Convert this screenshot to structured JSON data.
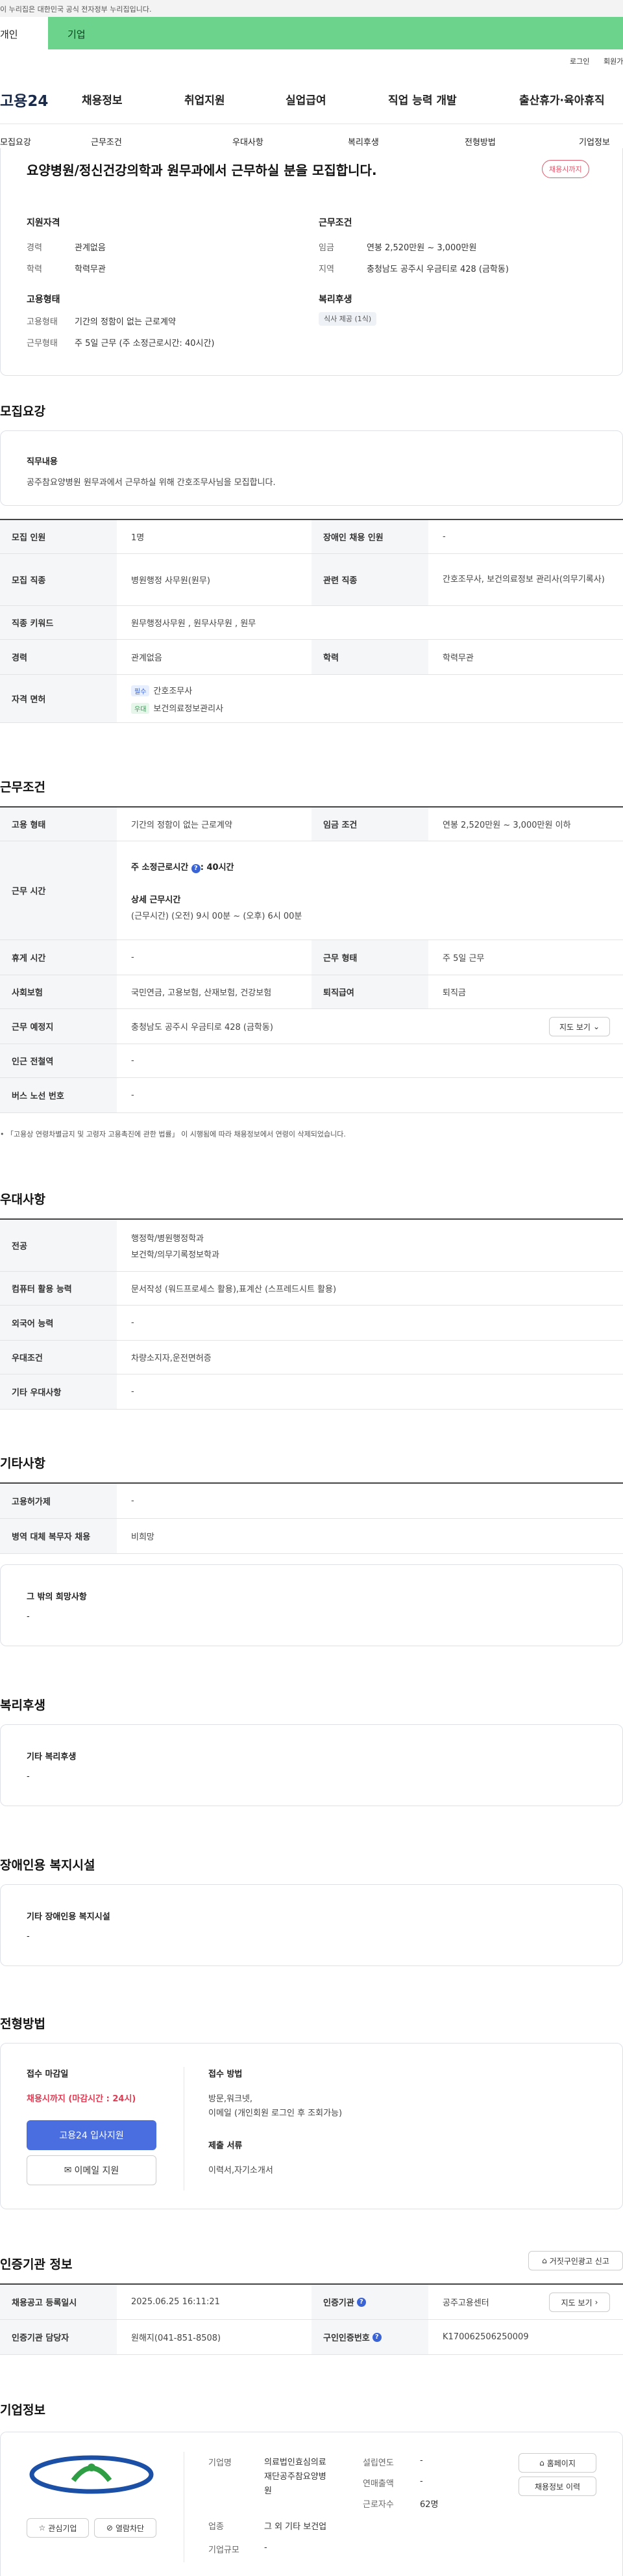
{
  "gov_banner": {
    "text": "이 누리집은 대한민국 공식 전자정부 누리집입니다."
  },
  "user_tabs": [
    {
      "label": "개인"
    },
    {
      "label": "기업"
    }
  ],
  "util_links": [
    {
      "label": "로그인"
    },
    {
      "label": "회원가입"
    }
  ],
  "logo": {
    "text": "고용24"
  },
  "gnb": [
    {
      "label": "채용정보"
    },
    {
      "label": "취업지원"
    },
    {
      "label": "실업급여"
    },
    {
      "label": "직업 능력 개발"
    },
    {
      "label": "출산휴가·육아휴직"
    }
  ],
  "anchor_tabs": [
    {
      "label": "모집요강"
    },
    {
      "label": "근무조건"
    },
    {
      "label": "우대사항"
    },
    {
      "label": "복리후생"
    },
    {
      "label": "전형방법"
    },
    {
      "label": "기업정보"
    }
  ],
  "summary": {
    "title": "요양병원/정신건강의학과 원무과에서 근무하실 분을 모집합니다.",
    "badge": "채용시까지",
    "qual_title": "지원자격",
    "career_k": "경력",
    "career_v": "관계없음",
    "edu_k": "학력",
    "edu_v": "학력무관",
    "cond_title": "근무조건",
    "wage_k": "임금",
    "wage_v": "연봉 2,520만원 ~ 3,000만원",
    "loc_k": "지역",
    "loc_v": "충청남도 공주시 우금티로 428 (금학동)",
    "emp_title": "고용형태",
    "emptype_k": "고용형태",
    "emptype_v": "기간의 정함이 없는 근로계약",
    "worktime_k": "근무형태",
    "worktime_v": "주 5일 근무 (주 소정근로시간: 40시간)",
    "welfare_title": "복리후생",
    "welfare_tag": "식사 제공 (1식)"
  },
  "recruit": {
    "title": "모집요강",
    "duty_label": "직무내용",
    "duty_text": "공주참요양병원 원무과에서 근무하실 위해 간호조무사님을 모집합니다.",
    "headcount_k": "모집 인원",
    "headcount_v": "1명",
    "disabled_k": "장애인 채용 인원",
    "disabled_v": "-",
    "job_k": "모집 직종",
    "job_v": "병원행정 사무원(원무)",
    "related_k": "관련 직종",
    "related_v": "간호조무사, 보건의료정보 관리사(의무기록사)",
    "keyword_k": "직종 키워드",
    "keyword_v": "원무행정사무원 , 원무사무원 , 원무",
    "career_k": "경력",
    "career_v": "관계없음",
    "edu_k": "학력",
    "edu_v": "학력무관",
    "license_k": "자격 면허",
    "license_req_tag": "필수",
    "license_req": "간호조무사",
    "license_pref_tag": "우대",
    "license_pref": "보건의료정보관리사"
  },
  "conditions": {
    "title": "근무조건",
    "emptype_k": "고용 형태",
    "emptype_v": "기간의 정함이 없는 근로계약",
    "wage_k": "임금 조건",
    "wage_v": "연봉 2,520만원 ~ 3,000만원 이하",
    "hours_k": "근무 시간",
    "hours_std": "주 소정근로시간",
    "hours_std_v": ": 40시간",
    "hours_detail_t": "상세 근무시간",
    "hours_detail_v": "(근무시간) (오전) 9시 00분 ~ (오후) 6시 00분",
    "break_k": "휴게 시간",
    "break_v": "-",
    "shift_k": "근무 형태",
    "shift_v": "주 5일 근무",
    "insurance_k": "사회보험",
    "insurance_v": "국민연금, 고용보험, 산재보험, 건강보험",
    "severance_k": "퇴직급여",
    "severance_v": "퇴직금",
    "place_k": "근무 예정지",
    "place_v": "충청남도 공주시 우금티로 428 (금학동)",
    "map_btn": "지도 보기",
    "subway_k": "인근 전철역",
    "subway_v": "-",
    "bus_k": "버스 노선 번호",
    "bus_v": "-",
    "note": "「고용상 연령차별금지 및 고령자 고용촉진에 관한 법률」 이 시행됨에 따라 채용정보에서 연령이 삭제되었습니다."
  },
  "preferences": {
    "title": "우대사항",
    "major_k": "전공",
    "major_v1": "행정학/병원행정학과",
    "major_v2": "보건학/의무기록정보학과",
    "computer_k": "컴퓨터 활용 능력",
    "computer_v": "문서작성 (워드프로세스 활용),표계산 (스프레드시트 활용)",
    "language_k": "외국어 능력",
    "language_v": "-",
    "pref_k": "우대조건",
    "pref_v": "차량소지자,운전면허증",
    "etc_k": "기타 우대사항",
    "etc_v": "-"
  },
  "etc": {
    "title": "기타사항",
    "permit_k": "고용허가제",
    "permit_v": "-",
    "military_k": "병역 대체 복무자 채용",
    "military_v": "비희망",
    "other_label": "그 밖의 희망사항",
    "other_v": "-"
  },
  "welfare": {
    "title": "복리후생",
    "label": "기타 복리후생",
    "value": "-"
  },
  "disability": {
    "title": "장애인용 복지시설",
    "label": "기타 장애인용 복지시설",
    "value": "-"
  },
  "screening": {
    "title": "전형방법",
    "deadline_label": "접수 마감일",
    "deadline_v": "채용시까지 (마감시간 : 24시)",
    "apply_btn": "고용24 입사지원",
    "email_btn": "이메일 지원",
    "method_label": "접수 방법",
    "method_v1": "방문,워크넷,",
    "method_v2": "이메일 (개인회원 로그인 후 조회가능)",
    "docs_label": "제출 서류",
    "docs_v": "이력서,자기소개서"
  },
  "agency": {
    "title": "인증기관 정보",
    "report_btn": "거짓구인광고 신고",
    "reg_k": "채용공고 등록일시",
    "reg_v": "2025.06.25 16:11:21",
    "agency_k": "인증기관",
    "agency_v": "공주고용센터",
    "map_btn": "지도 보기",
    "manager_k": "인증기관 담당자",
    "manager_v": "원해지(041-851-8508)",
    "certno_k": "구인인증번호",
    "certno_v": "K170062506250009"
  },
  "company": {
    "title": "기업정보",
    "fav_btn": "관심기업",
    "block_btn": "열람차단",
    "name_k": "기업명",
    "name_v1": "의료법인효심의료",
    "name_v2": "재단공주참요양병",
    "name_v3": "원",
    "industry_k": "업종",
    "industry_v": "그 외 기타 보건업",
    "size_k": "기업규모",
    "size_v": "-",
    "founded_k": "설립연도",
    "founded_v": "-",
    "revenue_k": "연매출액",
    "revenue_v": "-",
    "employees_k": "근로자수",
    "employees_v": "62명",
    "homepage_btn": "홈페이지",
    "history_btn": "채용정보 이력"
  }
}
